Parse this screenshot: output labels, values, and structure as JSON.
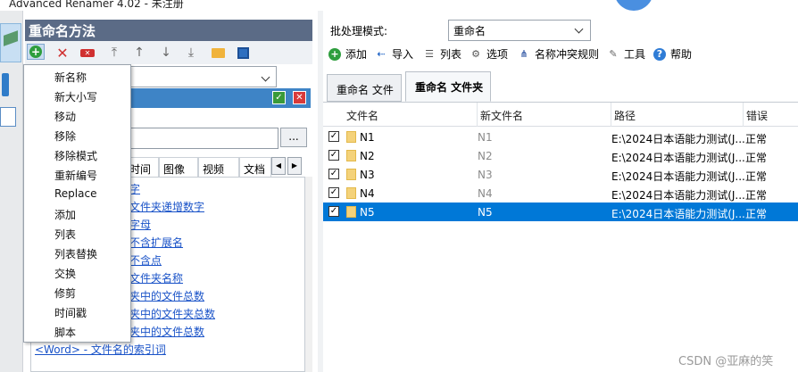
{
  "window": {
    "title": "Advanced Renamer 4.02 - 未注册"
  },
  "method_panel": {
    "header": "重命名方法",
    "ellipsis": "...",
    "tabs": [
      "时间",
      "图像",
      "视频",
      "文档"
    ],
    "scroll_left": "◀",
    "scroll_right": "▶",
    "tags": [
      "字",
      "文件夹递增数字",
      "字母",
      "不含扩展名",
      "不含点",
      "文件夹名称",
      "夹中的文件总数",
      "夹中的文件夹总数",
      "夹中的文件总数",
      "<Word> - 文件名的索引词"
    ]
  },
  "context_menu": {
    "items": [
      "新名称",
      "新大小写",
      "移动",
      "移除",
      "移除模式",
      "重新编号",
      "Replace",
      "添加",
      "列表",
      "列表替换",
      "交换",
      "修剪",
      "时间戳",
      "脚本"
    ]
  },
  "batch": {
    "label": "批处理模式:",
    "value": "重命名"
  },
  "toolbar": {
    "add": "添加",
    "import": "导入",
    "list": "列表",
    "options": "选项",
    "conflict": "名称冲突规则",
    "tools": "工具",
    "help": "帮助"
  },
  "tabs": {
    "files": "重命名 文件",
    "folders": "重命名 文件夹"
  },
  "grid": {
    "headers": [
      "文件名",
      "新文件名",
      "路径",
      "错误"
    ],
    "rows": [
      {
        "name": "N1",
        "new": "N1",
        "path": "E:\\2024日本语能力测试(J...",
        "status": "正常",
        "checked": "✓"
      },
      {
        "name": "N2",
        "new": "N2",
        "path": "E:\\2024日本语能力测试(J...",
        "status": "正常",
        "checked": "✓"
      },
      {
        "name": "N3",
        "new": "N3",
        "path": "E:\\2024日本语能力测试(J...",
        "status": "正常",
        "checked": "✓"
      },
      {
        "name": "N4",
        "new": "N4",
        "path": "E:\\2024日本语能力测试(J...",
        "status": "正常",
        "checked": "✓"
      },
      {
        "name": "N5",
        "new": "N5",
        "path": "E:\\2024日本语能力测试(J...",
        "status": "正常",
        "checked": "✓",
        "selected": true
      }
    ]
  },
  "watermark": "CSDN @亚麻的笑"
}
